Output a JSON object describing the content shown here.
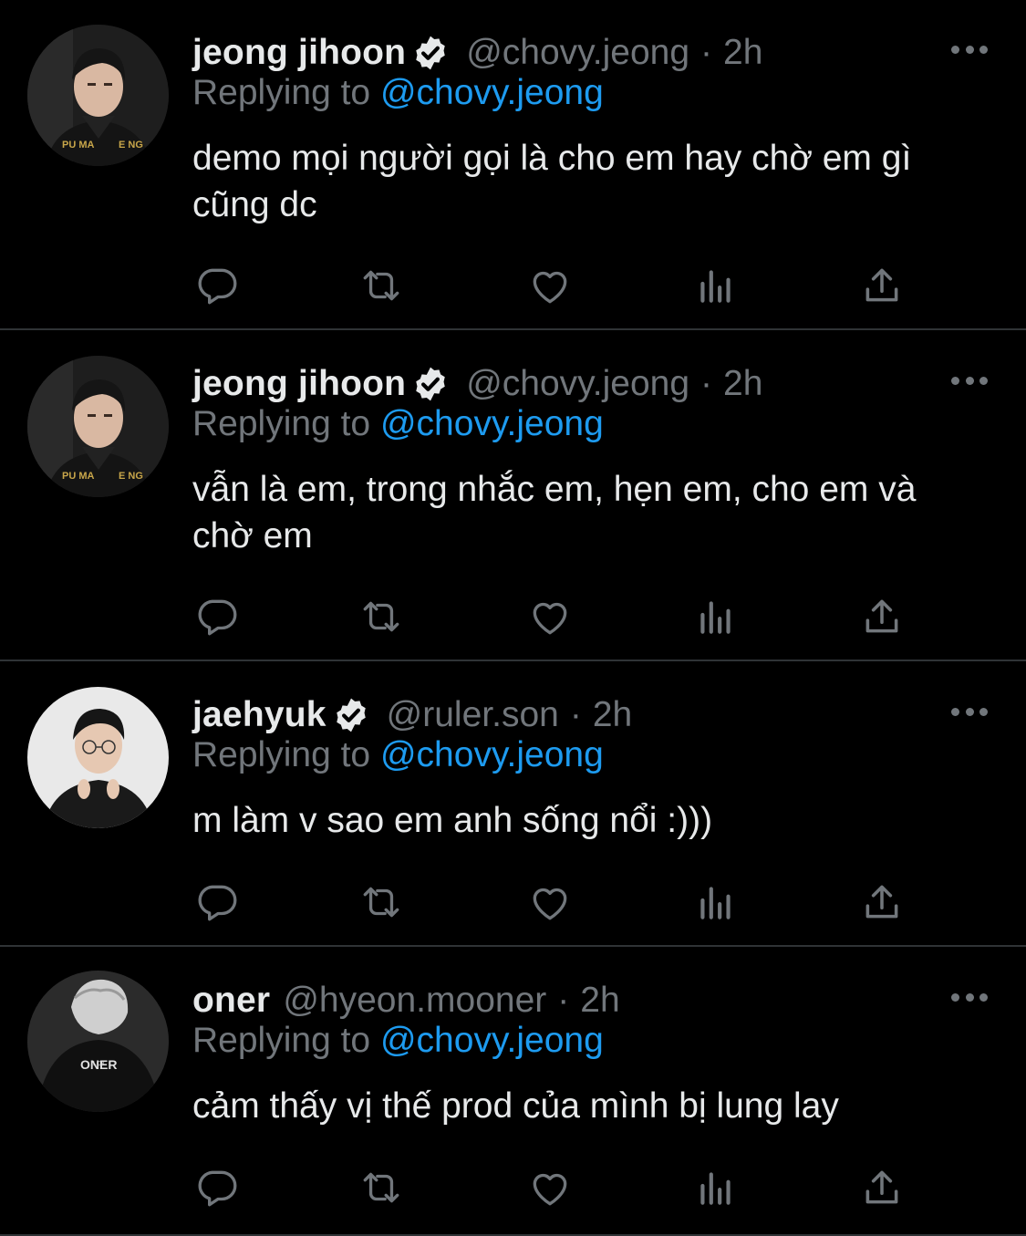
{
  "tweets": [
    {
      "display_name": "jeong jihoon",
      "verified": true,
      "handle": "@chovy.jeong",
      "separator": "·",
      "time": "2h",
      "replying_prefix": "Replying to",
      "replying_to": "@chovy.jeong",
      "text": "demo mọi người gọi là cho em hay chờ em gì cũng dc",
      "avatar_jersey_left": "PU MA",
      "avatar_jersey_right": "E NG"
    },
    {
      "display_name": "jeong jihoon",
      "verified": true,
      "handle": "@chovy.jeong",
      "separator": "·",
      "time": "2h",
      "replying_prefix": "Replying to",
      "replying_to": "@chovy.jeong",
      "text": "vẫn là em, trong nhắc em, hẹn em, cho em và chờ em",
      "avatar_jersey_left": "PU MA",
      "avatar_jersey_right": "E NG"
    },
    {
      "display_name": "jaehyuk",
      "verified": true,
      "handle": "@ruler.son",
      "separator": "·",
      "time": "2h",
      "replying_prefix": "Replying to",
      "replying_to": "@chovy.jeong",
      "text": "m làm v sao em anh sống nổi :)))"
    },
    {
      "display_name": "oner",
      "verified": false,
      "handle": "@hyeon.mooner",
      "separator": "·",
      "time": "2h",
      "replying_prefix": "Replying to",
      "replying_to": "@chovy.jeong",
      "text": "cảm thấy vị thế prod của mình bị lung lay",
      "avatar_jersey_text": "ONER"
    }
  ],
  "icons": {
    "reply": "reply-icon",
    "retweet": "retweet-icon",
    "like": "heart-icon",
    "views": "views-icon",
    "share": "share-icon",
    "more": "more-icon",
    "verified": "verified-badge-icon"
  },
  "colors": {
    "background": "#000000",
    "primary_text": "#e7e9ea",
    "secondary_text": "#71767b",
    "mention": "#1d9bf0",
    "divider": "#2f3336"
  }
}
